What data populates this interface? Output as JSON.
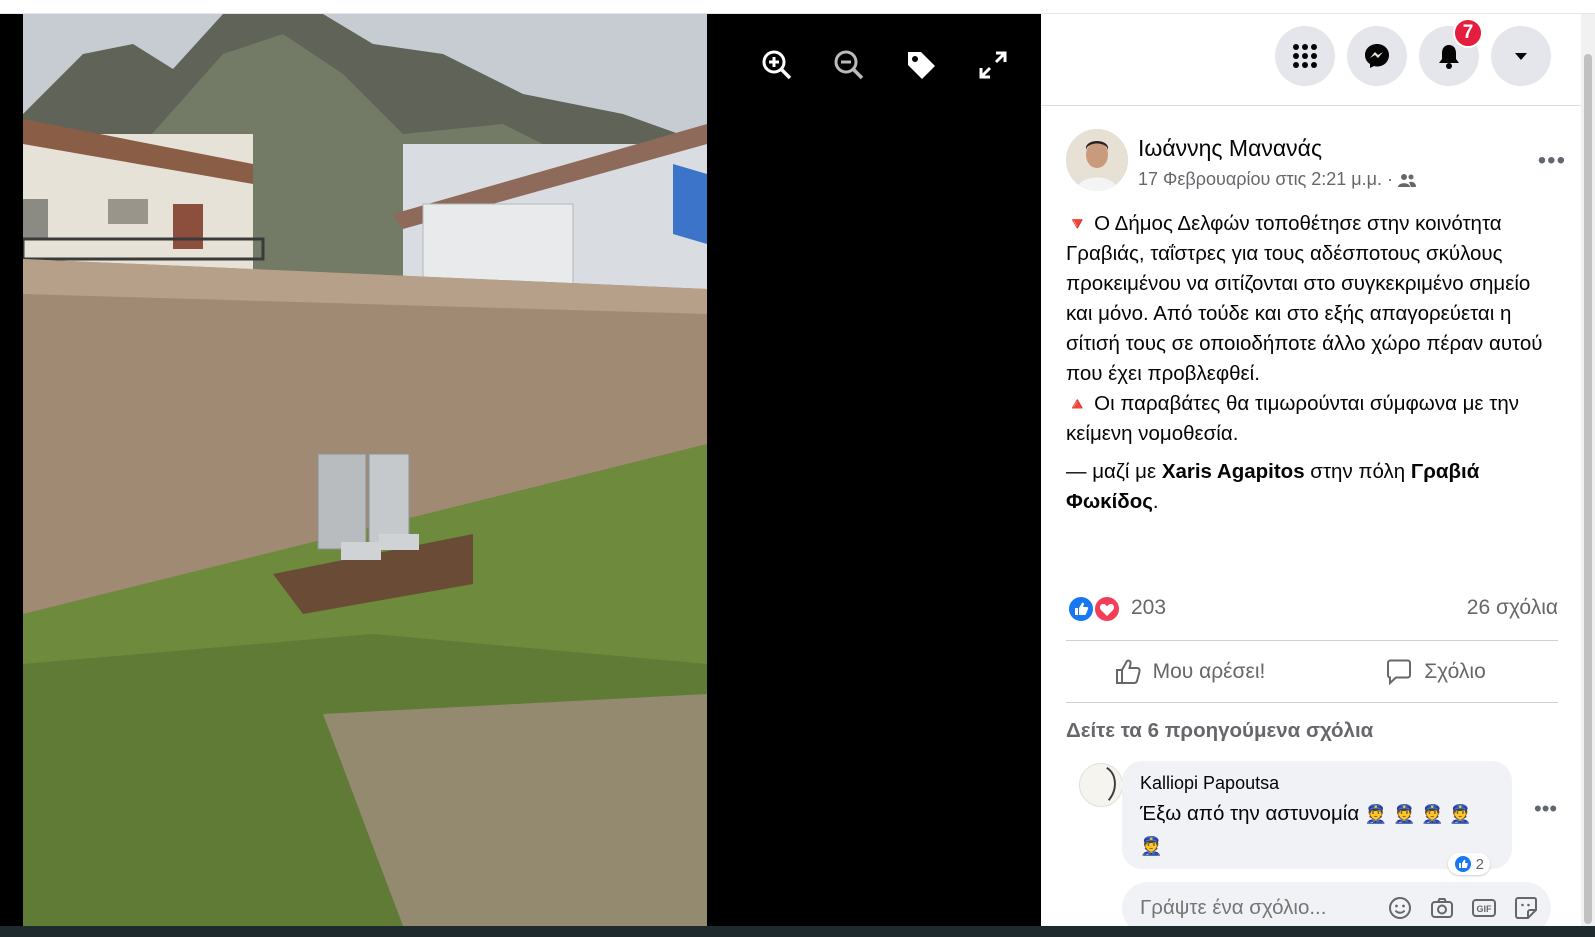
{
  "viewer": {
    "tools": [
      {
        "name": "zoom-in-icon"
      },
      {
        "name": "zoom-out-icon"
      },
      {
        "name": "tag-icon"
      },
      {
        "name": "fullscreen-icon"
      }
    ]
  },
  "topbar": {
    "notifications_count": "7",
    "icons": [
      "menu-grid-icon",
      "messenger-icon",
      "bell-icon",
      "caret-down-icon"
    ]
  },
  "post": {
    "author": "Ιωάννης Μανανάς",
    "timestamp": "17 Φεβρουαρίου στις 2:21 μ.μ. ·",
    "more": "•••",
    "paragraph1": "Ο Δήμος Δελφών τοποθέτησε στην κοινότητα Γραβιάς, ταΐστρες για τους αδέσποτους σκύλους προκειμένου να σιτίζονται στο συγκεκριμένο σημείο και μόνο. Από τούδε και στο εξής απαγορεύεται η σίτισή τους σε οποιοδήποτε άλλο χώρο πέραν αυτού που έχει προβλεφθεί.",
    "paragraph2": "Οι παραβάτες θα τιμωρούνται σύμφωνα με την κείμενη νομοθεσία.",
    "with_prefix": "— μαζί με",
    "with_person": "Xaris Agapitos",
    "with_mid": "στην πόλη",
    "with_place": "Γραβιά Φωκίδος",
    "with_end": "."
  },
  "stats": {
    "reactions": "203",
    "comments": "26 σχόλια"
  },
  "actions": {
    "like": "Μου αρέσει!",
    "comment": "Σχόλιο"
  },
  "comments": {
    "previous": "Δείτε τα 6 προηγούμενα σχόλια",
    "items": [
      {
        "author": "Kalliopi Papoutsa",
        "text": "Έξω από την αστυνομία",
        "emoji": "👮",
        "likes": "2"
      }
    ],
    "more": "•••",
    "composer_placeholder": "Γράψτε ένα σχόλιο..."
  },
  "colors": {
    "facebook_blue": "#1877f2",
    "badge_red": "#e41e3f",
    "triangle_red": "#e0245e"
  }
}
